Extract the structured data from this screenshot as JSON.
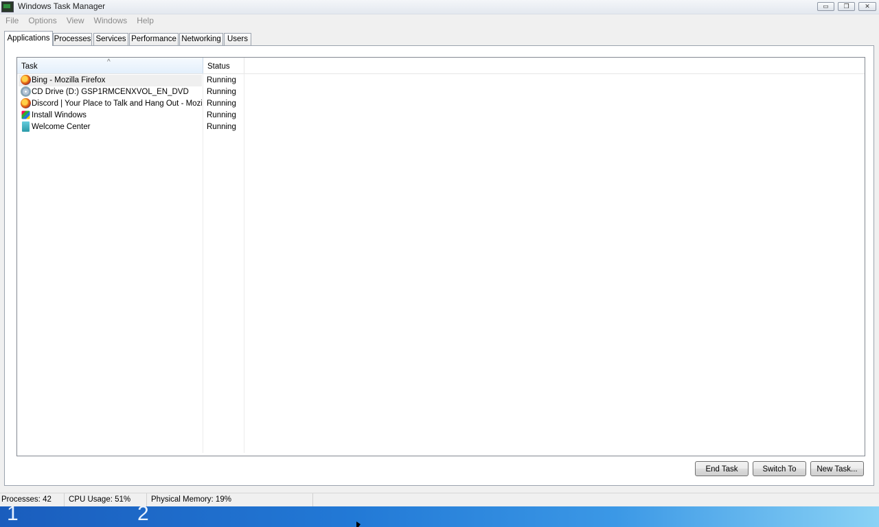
{
  "window": {
    "title": "Windows Task Manager",
    "controls": {
      "minimize": "▭",
      "restore": "❐",
      "close": "✕"
    }
  },
  "menu": [
    "File",
    "Options",
    "View",
    "Windows",
    "Help"
  ],
  "tabs": [
    "Applications",
    "Processes",
    "Services",
    "Performance",
    "Networking",
    "Users"
  ],
  "active_tab": "Applications",
  "list": {
    "columns": {
      "task": "Task",
      "status": "Status"
    },
    "sort_indicator": "^",
    "rows": [
      {
        "task": "Bing - Mozilla Firefox",
        "status": "Running",
        "icon": "firefox-icon"
      },
      {
        "task": "CD Drive (D:) GSP1RMCENXVOL_EN_DVD",
        "status": "Running",
        "icon": "cd-drive-icon"
      },
      {
        "task": "Discord | Your Place to Talk and Hang Out - Mozil...",
        "status": "Running",
        "icon": "firefox-icon"
      },
      {
        "task": "Install Windows",
        "status": "Running",
        "icon": "install-windows-icon"
      },
      {
        "task": "Welcome Center",
        "status": "Running",
        "icon": "welcome-center-icon"
      }
    ]
  },
  "buttons": {
    "end_task": "End Task",
    "switch_to": "Switch To",
    "new_task": "New Task..."
  },
  "status_bar": {
    "processes": "Processes: 42",
    "cpu": "CPU Usage: 51%",
    "memory": "Physical Memory: 19%"
  },
  "desktop": {
    "num1": "1",
    "num2": "2"
  }
}
